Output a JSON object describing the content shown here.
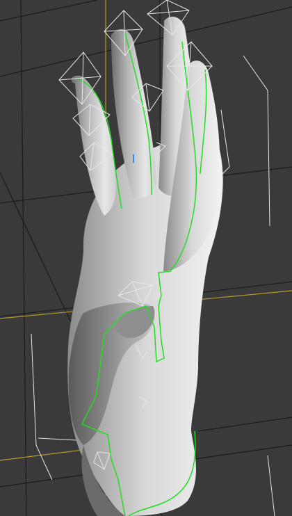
{
  "viewport": {
    "background": "#3a3a3a",
    "grid_color": "#1c1c1c",
    "axis_color": "#b59a2a"
  },
  "model": {
    "mesh_color": "#a9a9a9",
    "highlight_color": "#efefef",
    "seam_color": "#22dd22"
  },
  "gizmos": {
    "color": "#e8e8e8",
    "icon": "bone-octahedron-icon"
  }
}
